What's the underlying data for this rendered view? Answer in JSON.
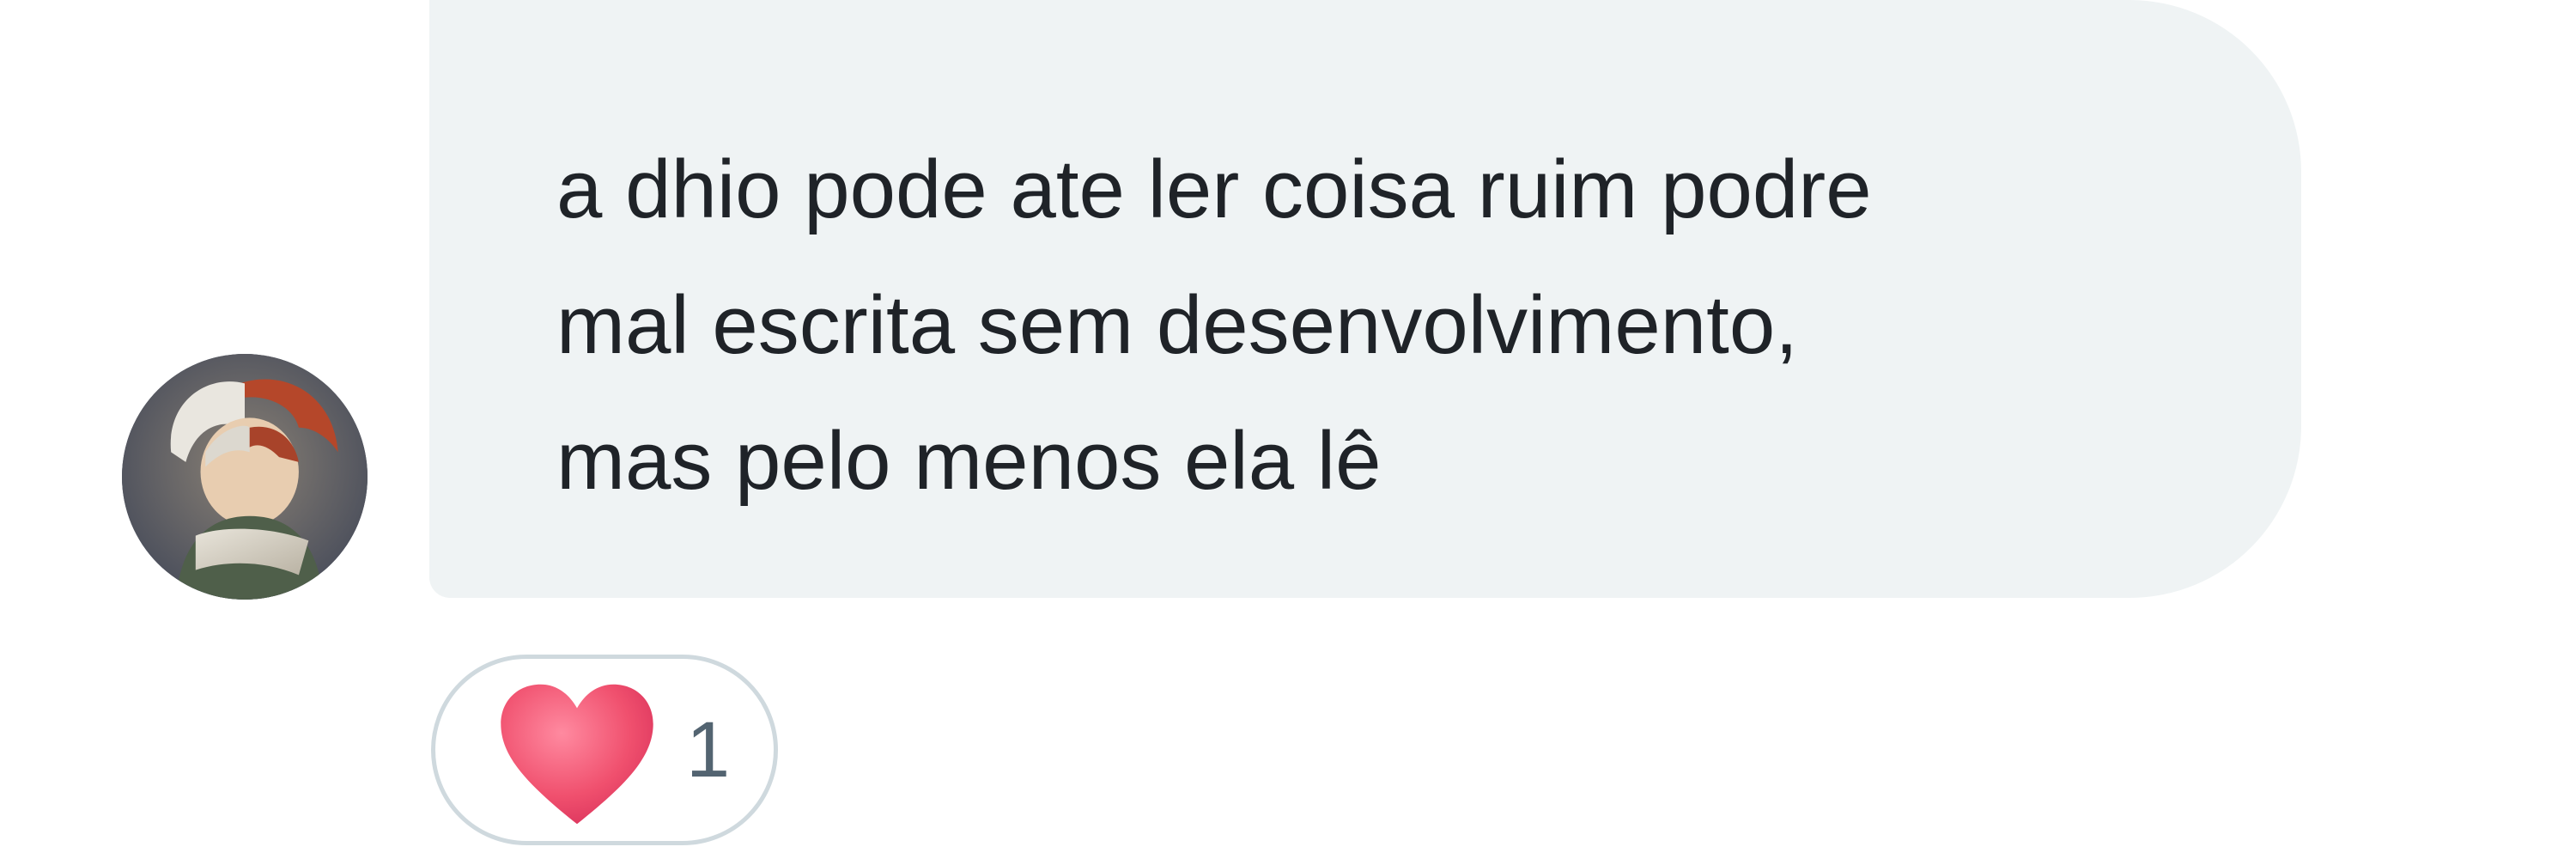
{
  "message": {
    "lines": [
      "a dhio pode ate ler coisa ruim podre",
      "mal escrita sem desenvolvimento,",
      "mas pelo menos ela lê"
    ]
  },
  "reaction": {
    "emoji_icon": "red-heart-icon",
    "count": "1"
  },
  "avatar": {
    "icon": "user-avatar"
  },
  "colors": {
    "bubble_bg": "#eff3f4",
    "text": "#1f2328",
    "reaction_border": "#cfd9de",
    "count_text": "#536471",
    "heart": "#f0506e"
  }
}
